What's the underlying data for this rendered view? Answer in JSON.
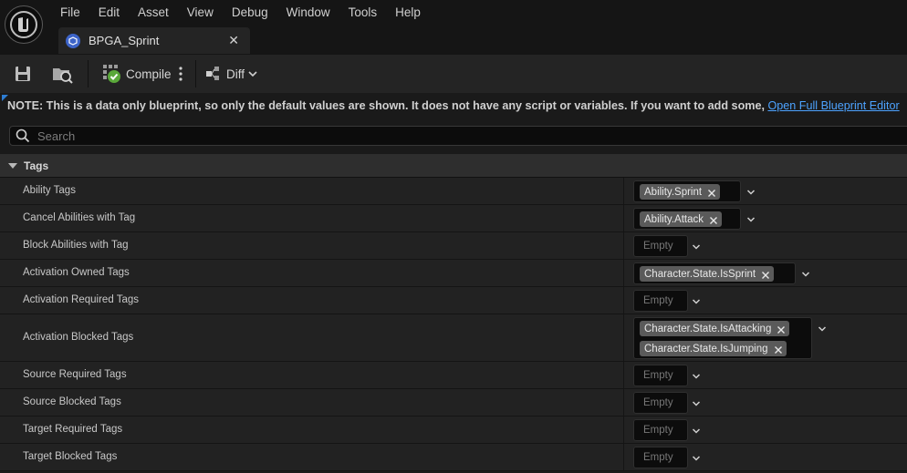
{
  "menu": [
    "File",
    "Edit",
    "Asset",
    "View",
    "Debug",
    "Window",
    "Tools",
    "Help"
  ],
  "tab": {
    "label": "BPGA_Sprint"
  },
  "toolbar": {
    "compile_label": "Compile",
    "diff_label": "Diff"
  },
  "note": {
    "text": "NOTE: This is a data only blueprint, so only the default values are shown.  It does not have any script or variables.  If you want to add some, ",
    "link": "Open Full Blueprint Editor"
  },
  "search": {
    "placeholder": "Search"
  },
  "category": {
    "label": "Tags"
  },
  "empty_label": "Empty",
  "properties": [
    {
      "name": "Ability Tags",
      "tags": [
        "Ability.Sprint"
      ]
    },
    {
      "name": "Cancel Abilities with Tag",
      "tags": [
        "Ability.Attack"
      ]
    },
    {
      "name": "Block Abilities with Tag",
      "tags": []
    },
    {
      "name": "Activation Owned Tags",
      "tags": [
        "Character.State.IsSprint"
      ]
    },
    {
      "name": "Activation Required Tags",
      "tags": []
    },
    {
      "name": "Activation Blocked Tags",
      "tags": [
        "Character.State.IsAttacking",
        "Character.State.IsJumping"
      ]
    },
    {
      "name": "Source Required Tags",
      "tags": []
    },
    {
      "name": "Source Blocked Tags",
      "tags": []
    },
    {
      "name": "Target Required Tags",
      "tags": []
    },
    {
      "name": "Target Blocked Tags",
      "tags": []
    }
  ]
}
